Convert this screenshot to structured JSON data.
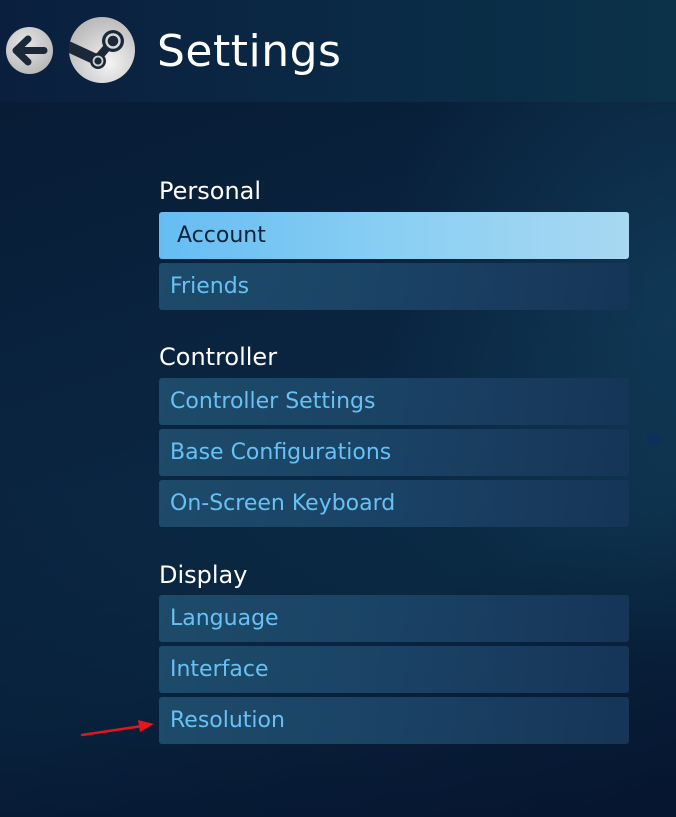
{
  "header": {
    "title": "Settings",
    "back_icon": "arrow-left-icon",
    "logo_icon": "steam-logo-icon"
  },
  "sections": [
    {
      "title": "Personal",
      "items": [
        {
          "label": "Account",
          "selected": true
        },
        {
          "label": "Friends",
          "selected": false
        }
      ]
    },
    {
      "title": "Controller",
      "items": [
        {
          "label": "Controller Settings",
          "selected": false
        },
        {
          "label": "Base Configurations",
          "selected": false
        },
        {
          "label": "On-Screen Keyboard",
          "selected": false
        }
      ]
    },
    {
      "title": "Display",
      "items": [
        {
          "label": "Language",
          "selected": false
        },
        {
          "label": "Interface",
          "selected": false
        },
        {
          "label": "Resolution",
          "selected": false
        }
      ]
    }
  ],
  "annotation": {
    "type": "red-arrow",
    "target": "Resolution",
    "color": "#e8141c"
  },
  "colors": {
    "accent": "#67c1f5",
    "selected_bg": "#8acff3",
    "selected_text": "#0e2438",
    "item_bg": "#1a4264",
    "heading_text": "#ffffff"
  }
}
